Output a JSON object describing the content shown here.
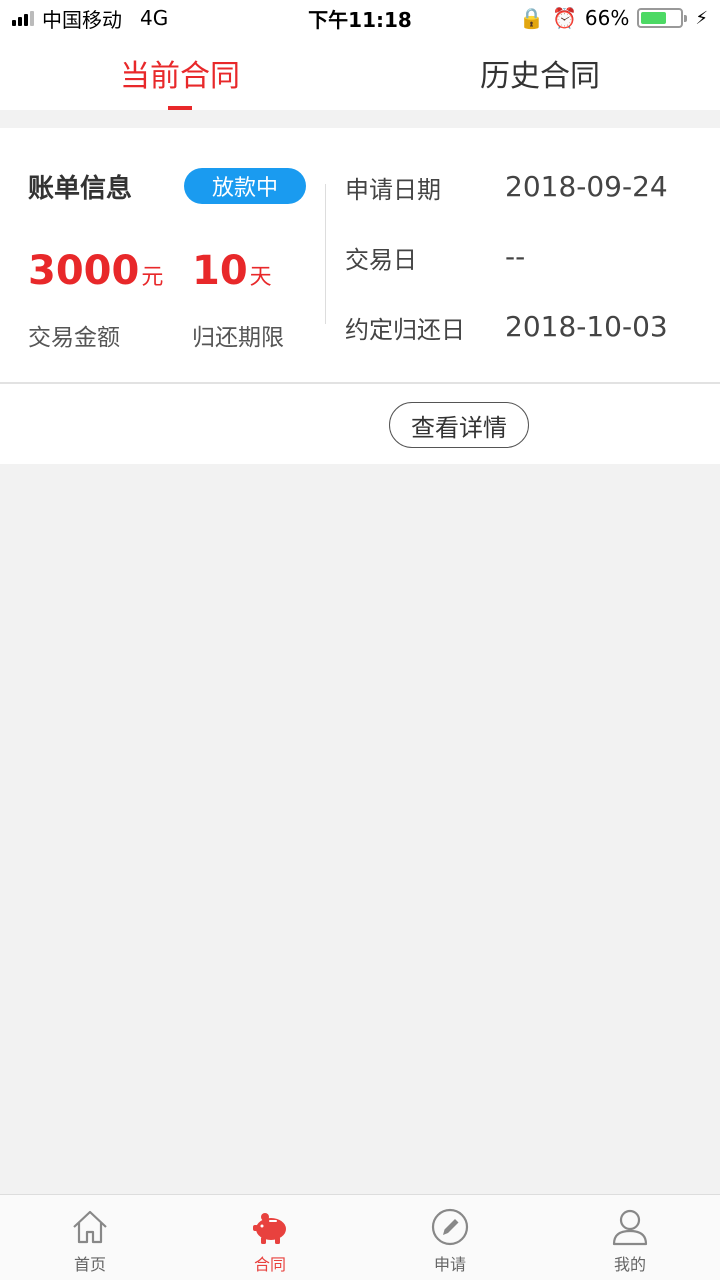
{
  "status_bar": {
    "carrier": "中国移动",
    "network": "4G",
    "time": "下午11:18",
    "battery": "66%",
    "battery_level": 0.66
  },
  "tabs": [
    {
      "label": "当前合同",
      "active": true
    },
    {
      "label": "历史合同",
      "active": false
    }
  ],
  "bill": {
    "title": "账单信息",
    "status": "放款中",
    "amount": "3000",
    "amount_unit": "元",
    "amount_label": "交易金额",
    "period": "10",
    "period_unit": "天",
    "period_label": "归还期限",
    "apply_date_label": "申请日期",
    "apply_date": "2018-09-24",
    "trade_date_label": "交易日",
    "trade_date": "--",
    "due_date_label": "约定归还日",
    "due_date": "2018-10-03",
    "detail_button": "查看详情"
  },
  "bottom_nav": [
    {
      "label": "首页",
      "icon": "home-icon",
      "active": false
    },
    {
      "label": "合同",
      "icon": "piggy-bank-icon",
      "active": true
    },
    {
      "label": "申请",
      "icon": "pencil-icon",
      "active": false
    },
    {
      "label": "我的",
      "icon": "user-icon",
      "active": false
    }
  ],
  "colors": {
    "accent": "#e8282a",
    "badge": "#1a9bf0",
    "background": "#f2f2f2"
  }
}
